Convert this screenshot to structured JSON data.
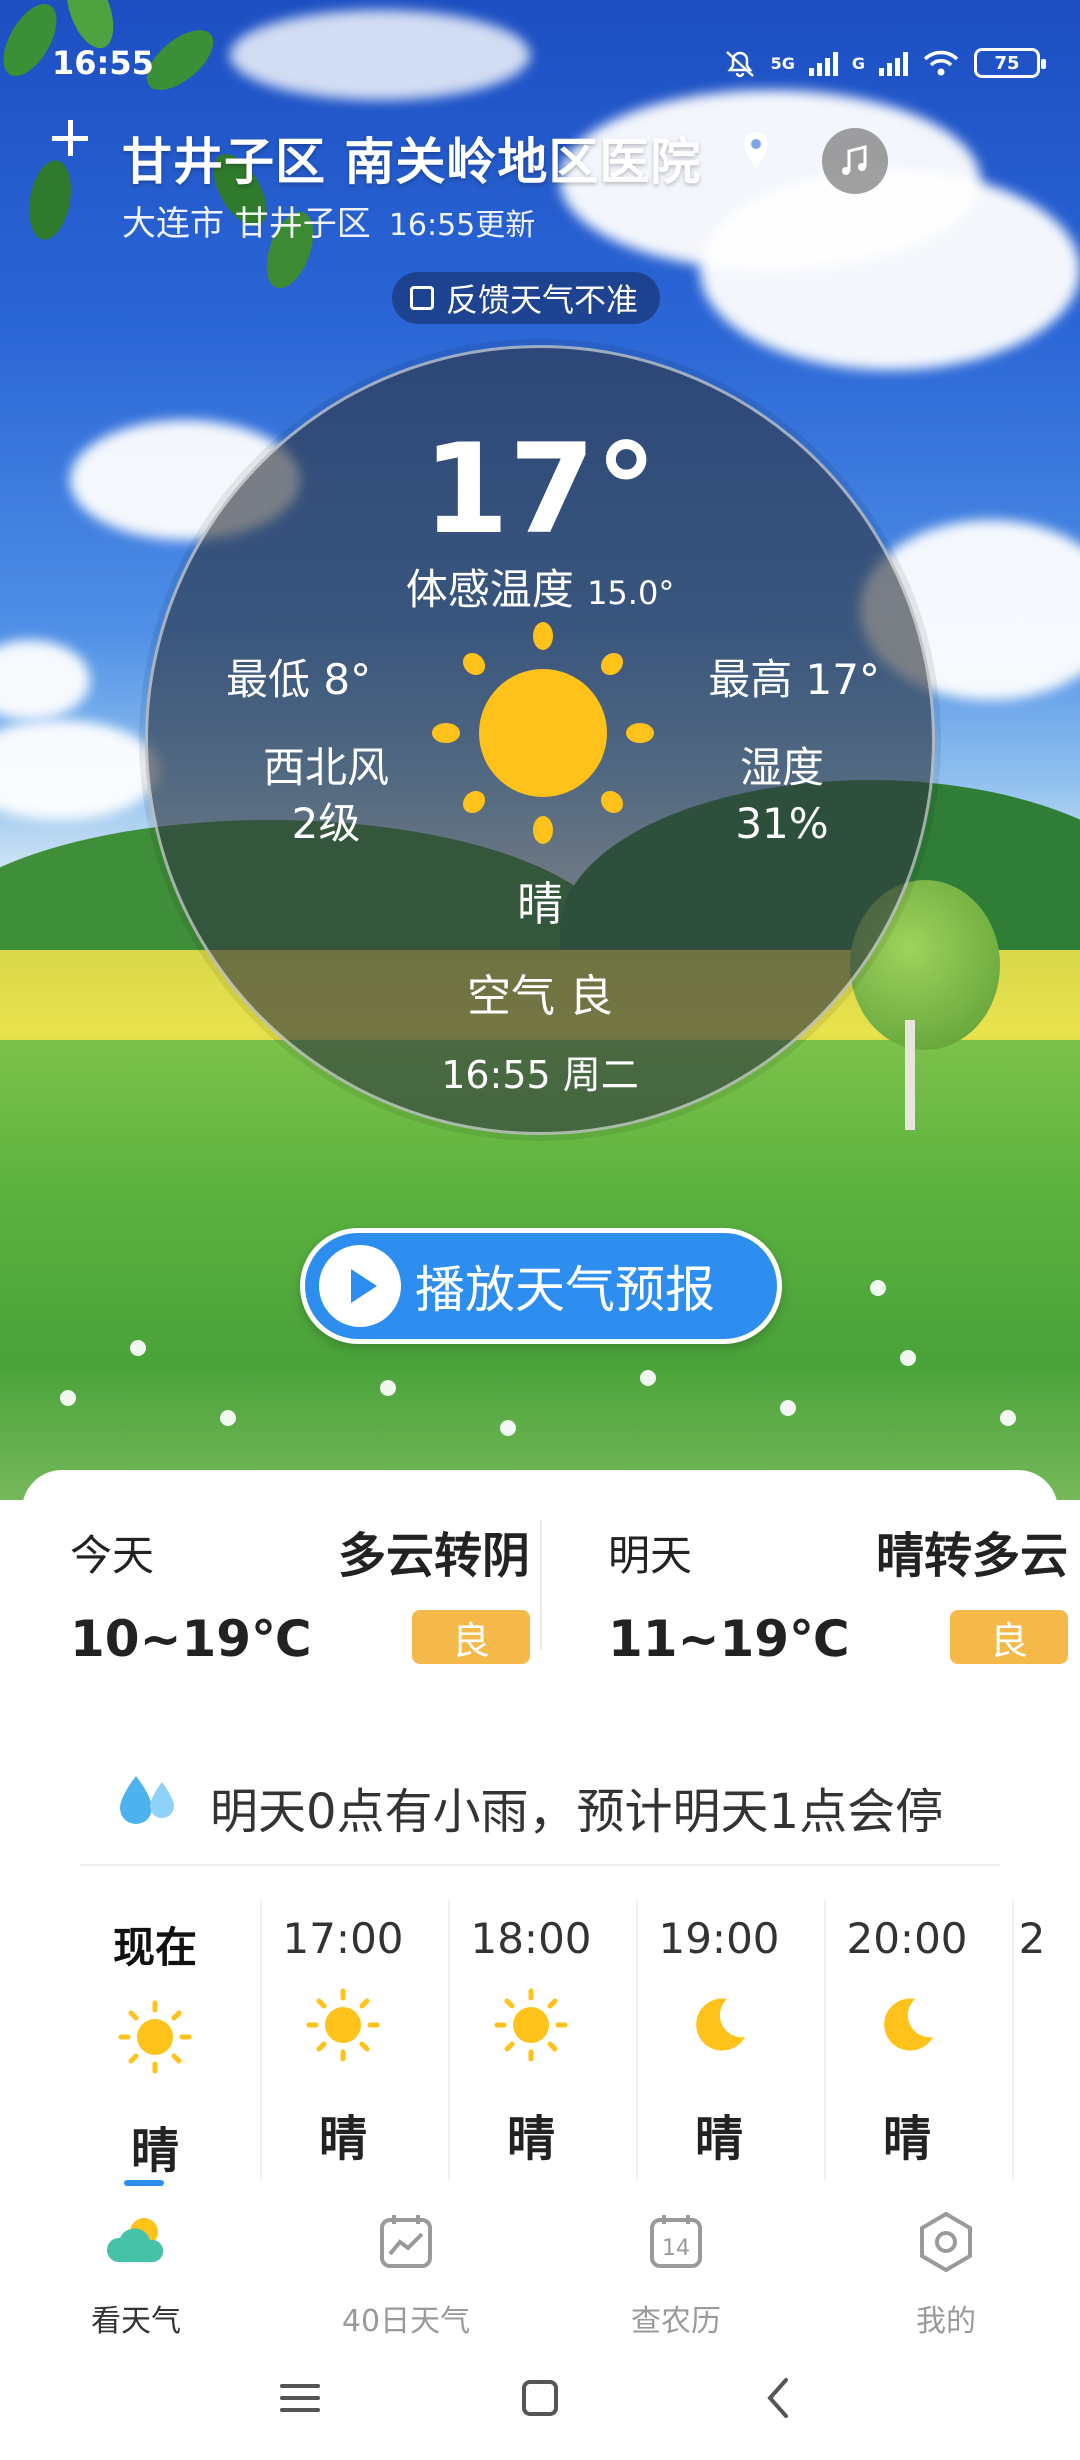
{
  "status_bar": {
    "time": "16:55",
    "network_1": "5G",
    "network_2": "G",
    "battery": "75"
  },
  "header": {
    "location": "甘井子区 南关岭地区医院",
    "city": "大连市 甘井子区",
    "updated": "16:55更新",
    "feedback_label": "反馈天气不准"
  },
  "current": {
    "temperature": "17°",
    "feels_like_label": "体感温度",
    "feels_like_value": "15.0°",
    "low_label": "最低 8°",
    "high_label": "最高 17°",
    "wind_dir": "西北风",
    "wind_level": "2级",
    "humidity_label": "湿度",
    "humidity_value": "31%",
    "condition": "晴",
    "air_label": "空气 良",
    "datetime": "16:55 周二"
  },
  "play_button": {
    "label": "播放天气预报"
  },
  "forecast": {
    "today": {
      "label": "今天",
      "desc": "多云转阴",
      "range": "10~19℃",
      "aqi": "良"
    },
    "tomorrow": {
      "label": "明天",
      "desc": "晴转多云",
      "range": "11~19℃",
      "aqi": "良"
    }
  },
  "notice": {
    "text": "明天0点有小雨，预计明天1点会停"
  },
  "hourly": [
    {
      "time": "现在",
      "icon": "sun-icon",
      "cond": "晴"
    },
    {
      "time": "17:00",
      "icon": "sun-icon",
      "cond": "晴"
    },
    {
      "time": "18:00",
      "icon": "sun-icon",
      "cond": "晴"
    },
    {
      "time": "19:00",
      "icon": "moon-icon",
      "cond": "晴"
    },
    {
      "time": "20:00",
      "icon": "moon-icon",
      "cond": "晴"
    },
    {
      "time": "2",
      "icon": "",
      "cond": ""
    }
  ],
  "bottom_nav": [
    {
      "label": "看天气",
      "icon": "cloud-sun-icon",
      "active": true
    },
    {
      "label": "40日天气",
      "icon": "chart-calendar-icon",
      "active": false
    },
    {
      "label": "查农历",
      "icon": "calendar-14-icon",
      "day": "14",
      "active": false
    },
    {
      "label": "我的",
      "icon": "hexagon-settings-icon",
      "active": false
    }
  ],
  "colors": {
    "accent_blue": "#2d8ef0",
    "aqi_badge": "#f5b94a",
    "sun_yellow": "#ffc21a"
  }
}
